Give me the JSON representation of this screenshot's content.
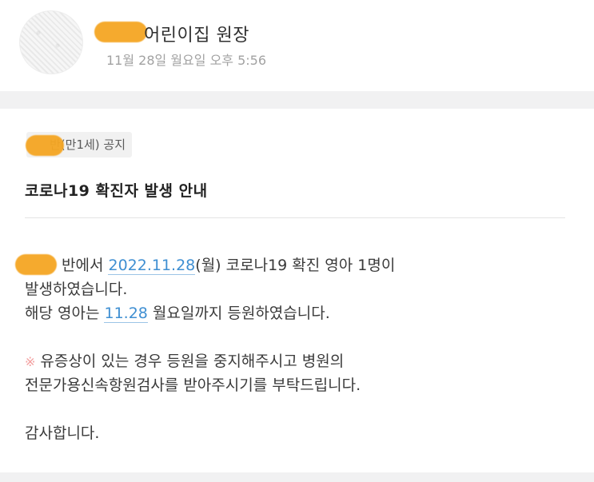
{
  "header": {
    "author": "어린이집 원장",
    "timestamp": "11월 28일 월요일 오후 5:56"
  },
  "post": {
    "category": "반(만1세) 공지",
    "title": "코로나19 확진자 발생 안내",
    "body": {
      "l1_a": "반에서 ",
      "l1_date": "2022.11.28",
      "l1_b": "(월) 코로나19 확진 영아 1명이",
      "l2": "발생하였습니다.",
      "l3_a": "해당 영아는 ",
      "l3_date": "11.28",
      "l3_b": " 월요일까지 등원하였습니다.",
      "l4_mark": "※",
      "l4": "유증상이 있는 경우 등원을 중지해주시고 병원의",
      "l5": "전문가용신속항원검사를 받아주시기를 부탁드립니다.",
      "l6": "감사합니다."
    }
  },
  "colors": {
    "link": "#3f8fd2",
    "censor": "#f5a623",
    "notice_mark": "#f3a0a0",
    "separator_band": "#f1f1f2"
  }
}
